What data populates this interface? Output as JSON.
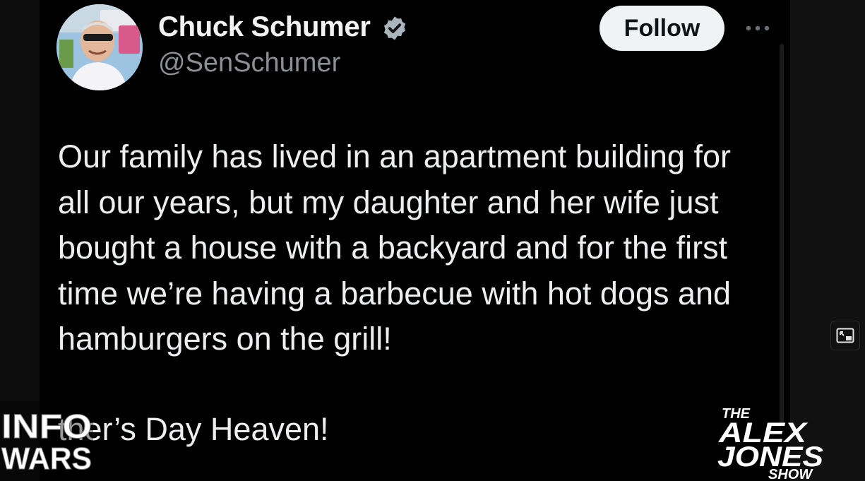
{
  "tweet": {
    "display_name": "Chuck Schumer",
    "handle": "@SenSchumer",
    "follow_label": "Follow",
    "body_lines": [
      "Our family has lived in an apartment building for",
      "all our years, but my daughter and her wife just",
      "bought a house with a backyard and for the first",
      "time we’re having a barbecue with hot dogs and",
      "hamburgers on the grill!"
    ],
    "tail_text": "ther’s Day Heaven!"
  },
  "icons": {
    "verified": "verified-badge-icon",
    "more": "more-options-icon",
    "pip": "picture-in-picture-icon"
  },
  "overlays": {
    "infowars_logo_lines": [
      "INFO",
      "WARS"
    ],
    "alex_jones_logo_lines": [
      "THE",
      "ALEX",
      "JONES",
      "SHOW"
    ]
  },
  "colors": {
    "background": "#000000",
    "text": "#e7e9ea",
    "handle": "#8b8f94",
    "follow_button_bg": "#eff3f4",
    "follow_button_text": "#0f1419"
  }
}
